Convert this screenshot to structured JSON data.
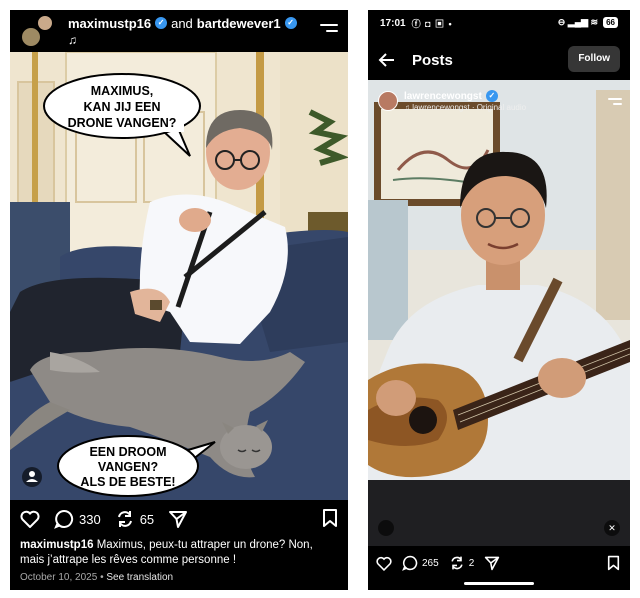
{
  "left_post": {
    "header": {
      "user1": "maximustp16",
      "and": "and",
      "user2": "bartdewever1",
      "music_icon": "music-note-icon"
    },
    "bubble_top": [
      "MAXIMUS,",
      "KAN JIJ EEN",
      "DRONE VANGEN?"
    ],
    "bubble_bottom": [
      "EEN DROOM",
      "VANGEN?",
      "ALS DE BESTE!"
    ],
    "actions": {
      "comments": "330",
      "reposts": "65"
    },
    "caption": {
      "username": "maximustp16",
      "text": "Maximus, peux-tu attraper un drone? Non, mais j’attrape les rêves comme personne !"
    },
    "meta": {
      "date": "October 10, 2025",
      "separator": "•",
      "translate": "See translation"
    }
  },
  "right_post": {
    "status_bar": {
      "time": "17:01",
      "battery": "66"
    },
    "nav": {
      "title": "Posts",
      "follow": "Follow"
    },
    "author": {
      "username": "lawrencewongst",
      "audio": "lawrencewongst · Original audio"
    },
    "actions": {
      "comments": "265",
      "reposts": "2"
    }
  },
  "colors": {
    "background": "#000000",
    "verified": "#3897f0",
    "follow_button": "#363636",
    "muted_text": "#a8a8a8"
  }
}
